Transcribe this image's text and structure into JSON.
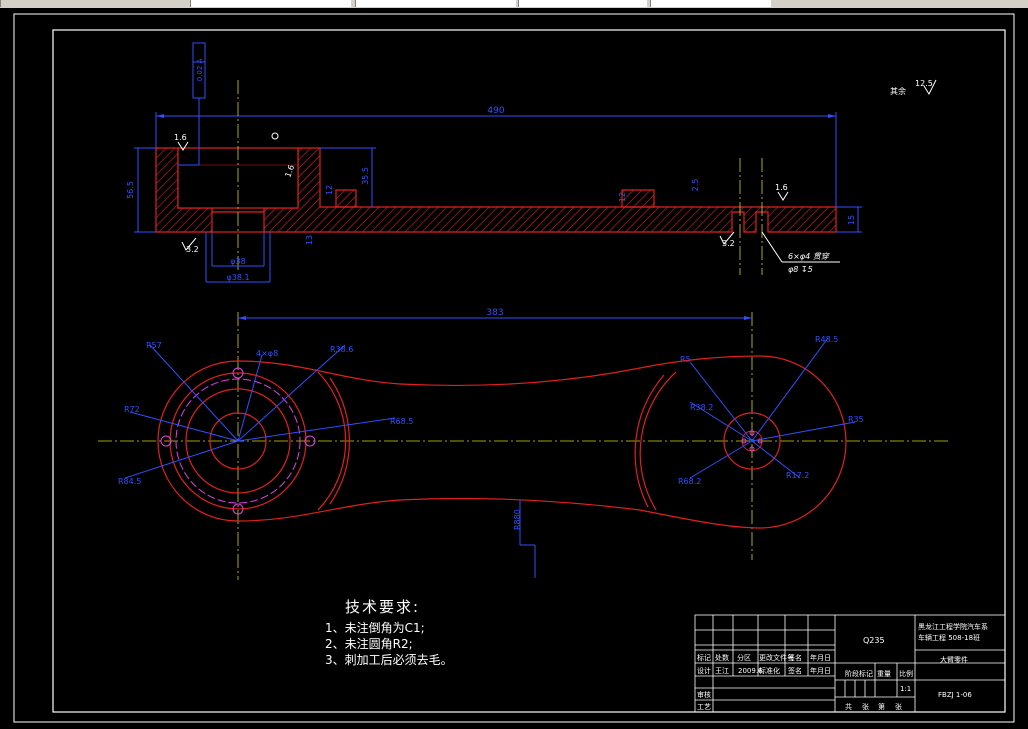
{
  "drawing": {
    "overall_length": "490",
    "center_distance": "383",
    "general_roughness": "12.5",
    "general_roughness_prefix": "其余",
    "section_view": {
      "roughness_left": "1.6",
      "roughness_right": "1.6",
      "roughness_bottom_left": "3.2",
      "roughness_bottom_right": "3.2",
      "roughness_inner": "1.6",
      "dia_bore": "φ38",
      "dia_counterbore": "φ38.1",
      "height_left": "56.5",
      "depth_inner": "35.5",
      "height_right": "15",
      "step_a": "2.5",
      "step_b": "12",
      "step_c": "13",
      "step_d": "12",
      "hole_note_1": "6×φ4 贯穿",
      "hole_note_2": "φ8 ↧5",
      "datum_label": "A",
      "flag_text": "0.02 A"
    },
    "plan_view": {
      "left_labels": [
        "R57",
        "R72",
        "R84.5",
        "4×φ8",
        "R38.6",
        "R68.5"
      ],
      "right_labels": [
        "R5",
        "R38.2",
        "R68.2",
        "R48.5",
        "R35",
        "R17.2"
      ],
      "bottom_label": "R880"
    }
  },
  "tech_requirements": {
    "title": "技术要求:",
    "items": [
      "1、未注倒角为C1;",
      "2、未注圆角R2;",
      "3、刺加工后必须去毛。"
    ]
  },
  "title_block": {
    "material": "Q235",
    "school": "黑龙江工程学院汽车系",
    "class_name": "车辆工程 508-18班",
    "part_name": "大臂零件",
    "drawing_no": "FBZJ 1-06",
    "scale": "1:1",
    "designer": "王江",
    "date": "2009.6",
    "headers": {
      "mark": "标记",
      "count": "处数",
      "zone": "分区",
      "change_doc": "更改文件号",
      "sign": "签名",
      "ymd": "年月日",
      "design": "设计",
      "standardize": "标准化",
      "stage_mark": "阶段标记",
      "weight": "重量",
      "scale_h": "比例",
      "review": "审核",
      "process": "工艺",
      "approve": "批准",
      "sheets_total": "共",
      "sheets_unit": "张",
      "sheet_no": "第",
      "sheet_unit2": "张"
    }
  }
}
